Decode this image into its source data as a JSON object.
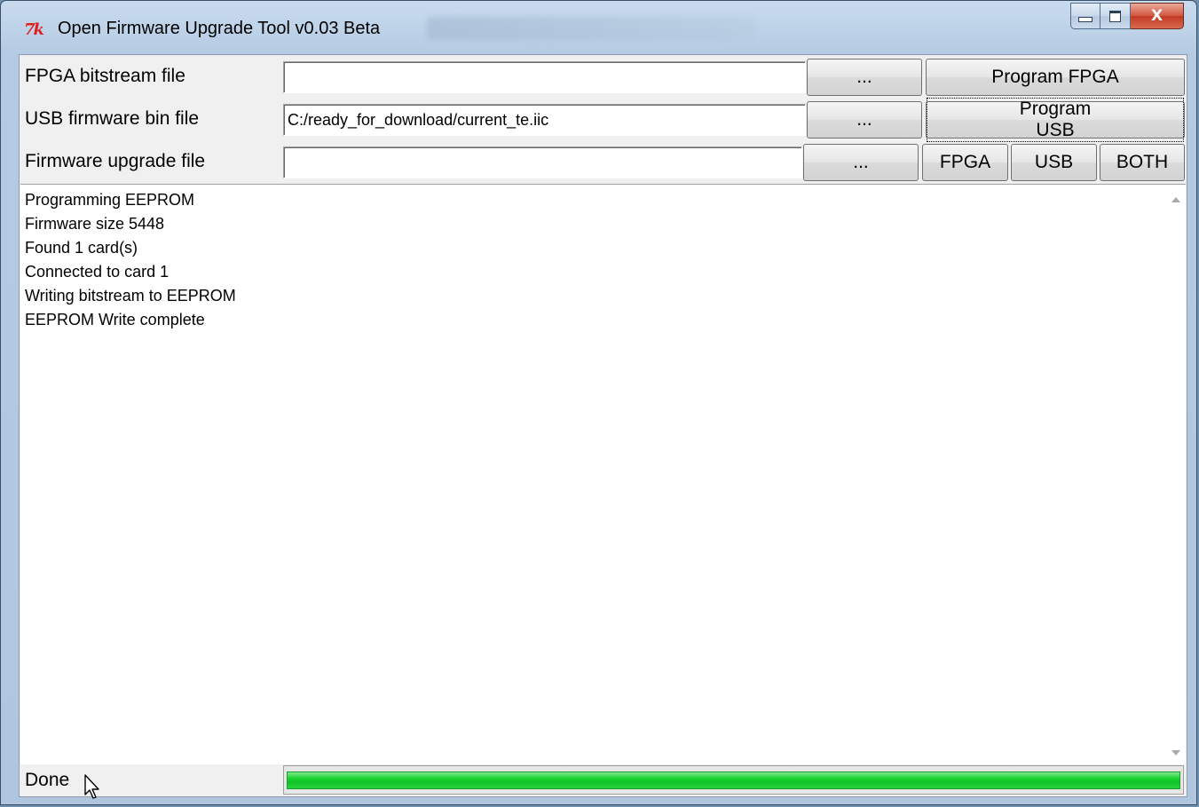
{
  "window": {
    "title": "Open Firmware Upgrade Tool v0.03 Beta",
    "icon": "tk-feather-icon",
    "close_label": "X"
  },
  "rows": [
    {
      "label": "FPGA bitstream file",
      "value": "",
      "browse_label": "...",
      "action_label": "Program FPGA"
    },
    {
      "label": "USB firmware bin file",
      "value": "C:/ready_for_download/current_te.iic",
      "browse_label": "...",
      "action_label": "Program USB"
    },
    {
      "label": "Firmware upgrade file",
      "value": "",
      "browse_label": "...",
      "fpga_label": "FPGA",
      "usb_label": "USB",
      "both_label": "BOTH"
    }
  ],
  "log": {
    "lines": [
      "Programming EEPROM",
      "Firmware size 5448",
      "Found 1 card(s)",
      "Connected to card 1",
      "Writing bitstream to EEPROM",
      "EEPROM Write complete"
    ]
  },
  "status": {
    "text": "Done",
    "progress_percent": 100,
    "progress_color": "#16d12f"
  }
}
